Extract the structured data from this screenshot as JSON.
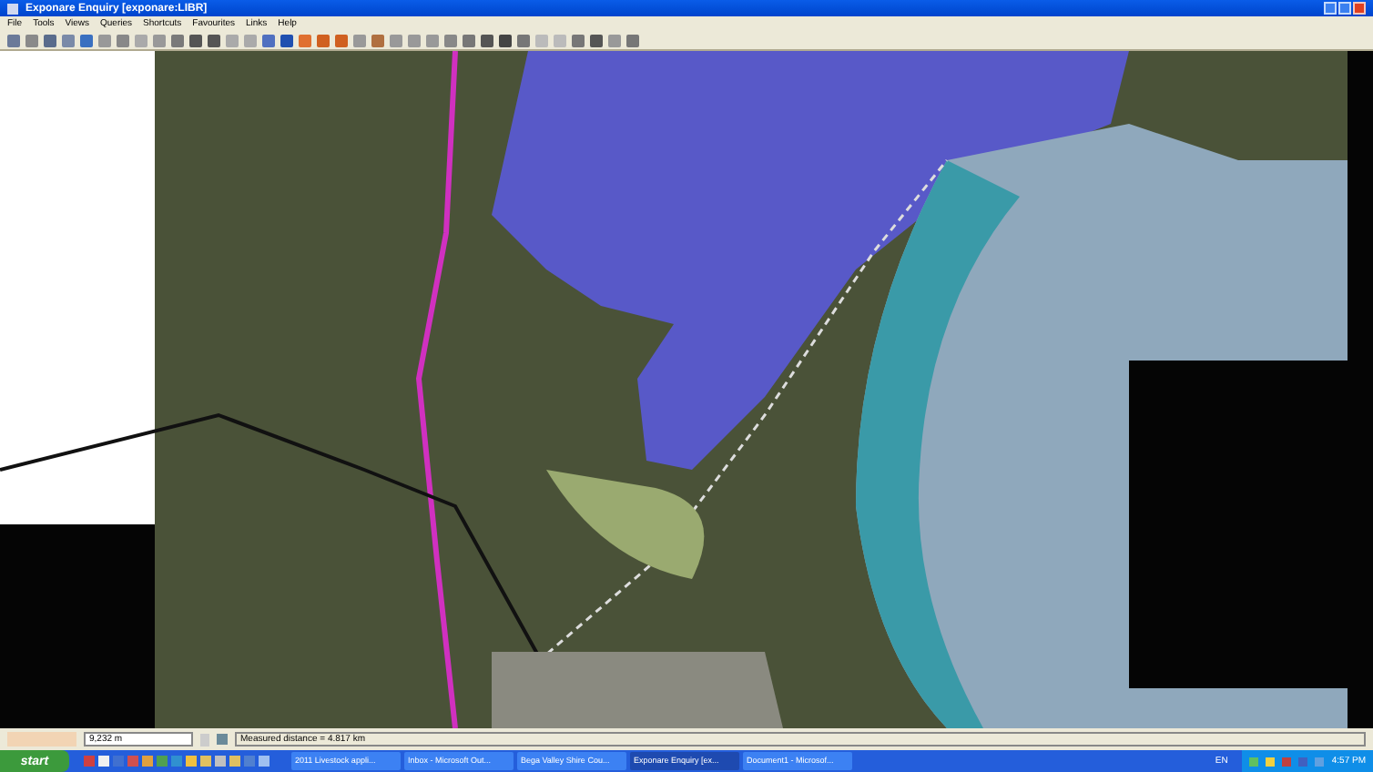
{
  "window": {
    "title": "Exponare Enquiry [exponare:LIBR]"
  },
  "menu": [
    "File",
    "Tools",
    "Views",
    "Queries",
    "Shortcuts",
    "Favourites",
    "Links",
    "Help"
  ],
  "status_bar": {
    "scale": "9,232 m",
    "message": "Measured distance = 4.817 km"
  },
  "taskbar": {
    "start": "start",
    "tasks": [
      {
        "label": "2011 Livestock appli...",
        "selected": false
      },
      {
        "label": "Inbox - Microsoft Out...",
        "selected": false
      },
      {
        "label": "Bega Valley Shire Cou...",
        "selected": false
      },
      {
        "label": "Exponare Enquiry [ex...",
        "selected": true
      },
      {
        "label": "Document1 - Microsof...",
        "selected": false
      }
    ],
    "language": "EN",
    "clock": "4:57 PM"
  }
}
